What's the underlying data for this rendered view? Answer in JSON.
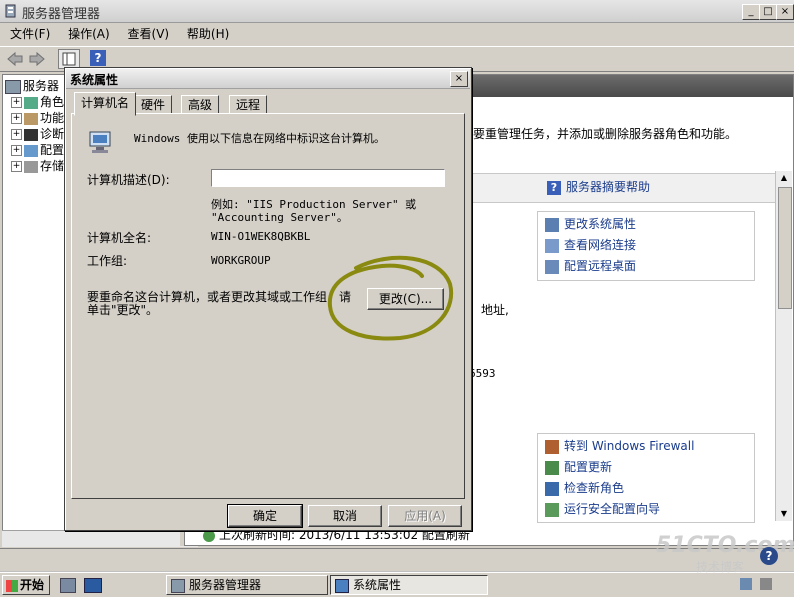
{
  "main_window": {
    "title": "服务器管理器",
    "controls": {
      "minimize": "_",
      "maximize": "□",
      "close": "×"
    },
    "menu": [
      "文件(F)",
      "操作(A)",
      "查看(V)",
      "帮助(H)"
    ],
    "tree": [
      {
        "label": "服务器",
        "expand": ""
      },
      {
        "label": "角色",
        "expand": "+"
      },
      {
        "label": "功能",
        "expand": "+"
      },
      {
        "label": "诊断",
        "expand": "+"
      },
      {
        "label": "配置",
        "expand": "+"
      },
      {
        "label": "存储",
        "expand": "+"
      }
    ],
    "content": {
      "intro_text": "要重管理任务，并添加或删除服务器角色和功能。",
      "help_link": "服务器摘要帮助",
      "links_group1": [
        "更改系统属性",
        "查看网络连接",
        "配置远程桌面"
      ],
      "partial_text_1": "地址,",
      "partial_text_2": "6593",
      "links_group2": [
        "转到 Windows Firewall",
        "配置更新",
        "检查新角色",
        "运行安全配置向导"
      ],
      "refresh_text": "上次刷新时间: 2013/6/11 13:53:02  配置刷新"
    }
  },
  "dialog": {
    "title": "系统属性",
    "close": "×",
    "tabs": [
      "计算机名",
      "硬件",
      "高级",
      "远程"
    ],
    "active_tab": "计算机名",
    "info_text": "Windows 使用以下信息在网络中标识这台计算机。",
    "description_label": "计算机描述(D):",
    "description_value": "",
    "example_text_1": "例如: \"IIS Production Server\" 或",
    "example_text_2": "\"Accounting Server\"。",
    "full_name_label": "计算机全名:",
    "full_name_value": "WIN-O1WEK8QBKBL",
    "workgroup_label": "工作组:",
    "workgroup_value": "WORKGROUP",
    "rename_text_1": "要重命名这台计算机，或者更改其域或工作组，请",
    "rename_text_2": "单击\"更改\"。",
    "change_button": "更改(C)...",
    "ok_button": "确定",
    "cancel_button": "取消",
    "apply_button": "应用(A)",
    "annotation_color": "#8a8a10"
  },
  "taskbar": {
    "start_label": "开始",
    "tasks": [
      "服务器管理器",
      "系统属性"
    ],
    "watermark": "51CTO.com",
    "watermark_sub": "技术博客"
  }
}
